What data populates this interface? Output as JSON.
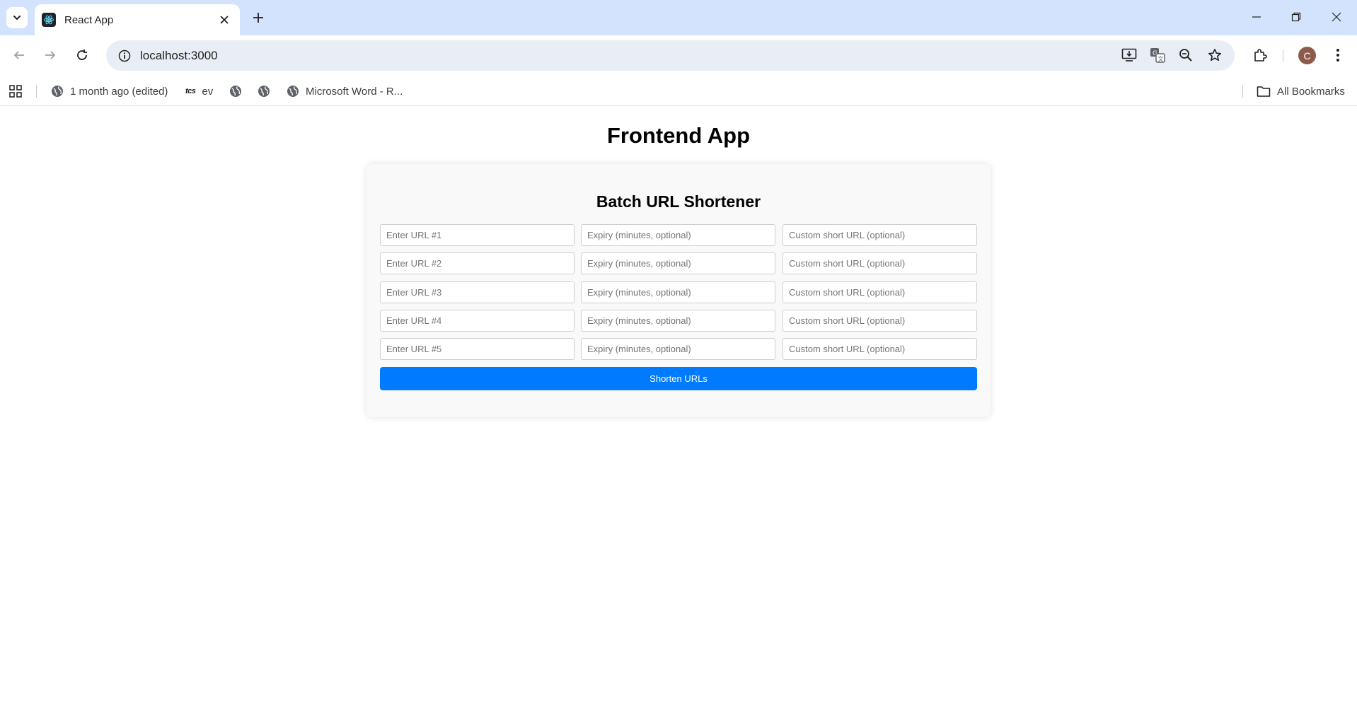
{
  "browser": {
    "tab_title": "React App",
    "url": "localhost:3000",
    "avatar_initial": "C",
    "bookmarks": {
      "item_1": "1 month ago (edited)",
      "item_2_prefix": "tcs",
      "item_2": "ev",
      "item_5": "Microsoft Word - R...",
      "all_bookmarks": "All Bookmarks"
    },
    "icons": {
      "tab_search": "chevron-down-icon",
      "favicon": "react-icon",
      "close": "close-icon",
      "new_tab": "plus-icon",
      "back": "arrow-left-icon",
      "forward": "arrow-right-icon",
      "reload": "reload-icon",
      "site_info": "info-icon",
      "install": "install-icon",
      "translate": "translate-icon",
      "zoom": "zoom-icon",
      "bookmark_star": "star-icon",
      "extensions": "puzzle-icon",
      "menu": "kebab-menu-icon",
      "apps": "apps-grid-icon",
      "globe": "globe-icon",
      "folder": "folder-icon"
    }
  },
  "app": {
    "title": "Frontend App",
    "form": {
      "heading": "Batch URL Shortener",
      "rows": [
        {
          "url_placeholder": "Enter URL #1",
          "expiry_placeholder": "Expiry (minutes, optional)",
          "custom_placeholder": "Custom short URL (optional)"
        },
        {
          "url_placeholder": "Enter URL #2",
          "expiry_placeholder": "Expiry (minutes, optional)",
          "custom_placeholder": "Custom short URL (optional)"
        },
        {
          "url_placeholder": "Enter URL #3",
          "expiry_placeholder": "Expiry (minutes, optional)",
          "custom_placeholder": "Custom short URL (optional)"
        },
        {
          "url_placeholder": "Enter URL #4",
          "expiry_placeholder": "Expiry (minutes, optional)",
          "custom_placeholder": "Custom short URL (optional)"
        },
        {
          "url_placeholder": "Enter URL #5",
          "expiry_placeholder": "Expiry (minutes, optional)",
          "custom_placeholder": "Custom short URL (optional)"
        }
      ],
      "submit_label": "Shorten URLs"
    },
    "colors": {
      "accent": "#007bff",
      "tabstrip": "#d3e3fd"
    }
  }
}
